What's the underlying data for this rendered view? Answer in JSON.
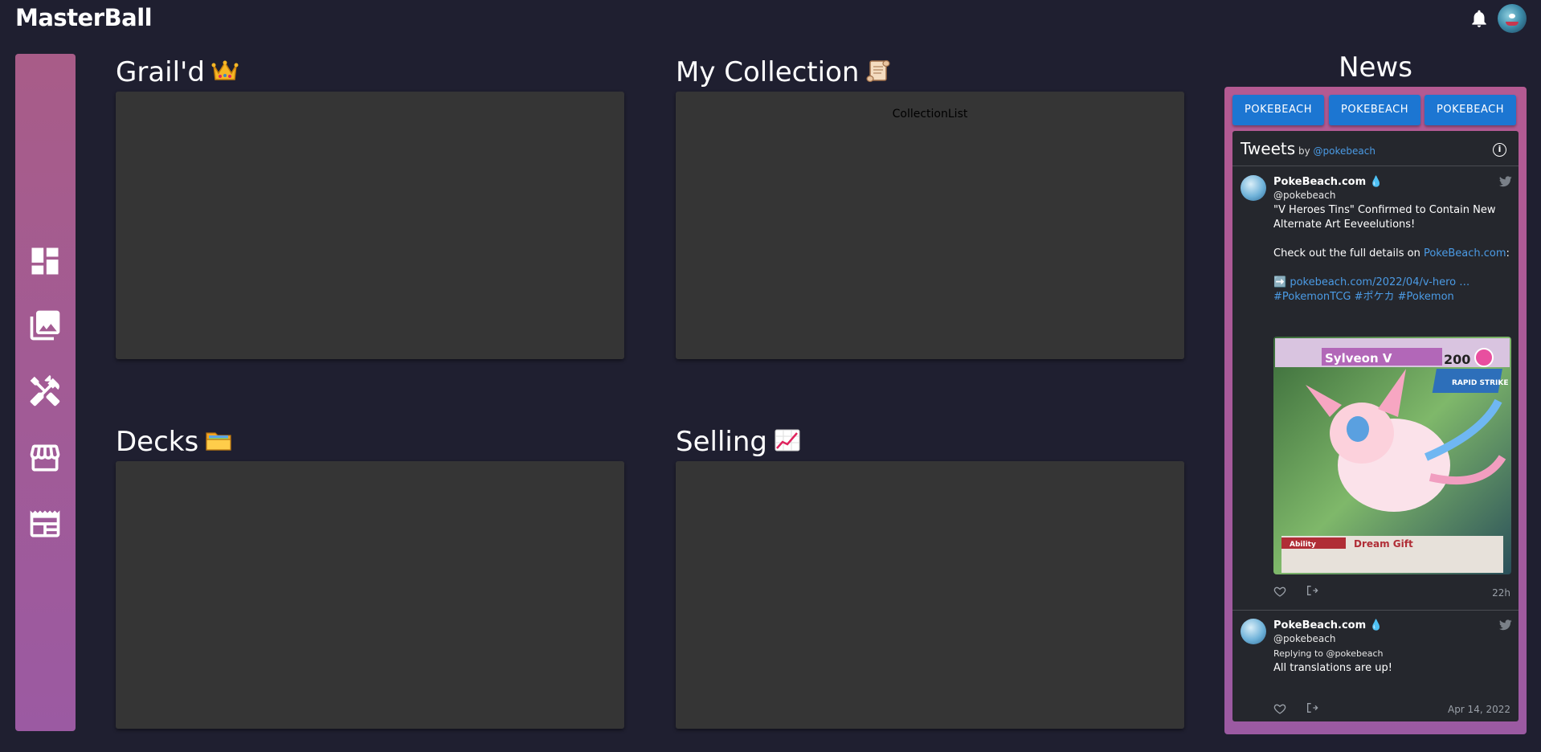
{
  "app": {
    "brand": "MasterBall",
    "notifications_icon": "bell-icon",
    "avatar_icon": "user-avatar"
  },
  "sidebar": {
    "items": [
      {
        "id": "dashboard",
        "icon": "dashboard-icon"
      },
      {
        "id": "collection",
        "icon": "photo-library-icon"
      },
      {
        "id": "tools",
        "icon": "tools-icon"
      },
      {
        "id": "store",
        "icon": "storefront-icon"
      },
      {
        "id": "news",
        "icon": "newspaper-icon"
      }
    ],
    "colors": {
      "top": "#a85c88",
      "bottom": "#9b5aa2"
    }
  },
  "sections": {
    "grailed": {
      "title": "Grail'd",
      "emoji": "crown-emoji"
    },
    "collection": {
      "title": "My Collection",
      "emoji": "scroll-emoji",
      "placeholder": "CollectionList"
    },
    "decks": {
      "title": "Decks",
      "emoji": "folder-emoji"
    },
    "selling": {
      "title": "Selling",
      "emoji": "chart-increasing-emoji"
    }
  },
  "news": {
    "title": "News",
    "sources": [
      "POKEBEACH",
      "POKEBEACH",
      "POKEBEACH"
    ],
    "button_color": "#1c76d2",
    "timeline": {
      "title": "Tweets",
      "by_prefix": "by",
      "by_handle": "@pokebeach",
      "info_label": "i"
    },
    "tweets": [
      {
        "name": "PokeBeach.com 💧",
        "handle": "@pokebeach",
        "line1": "\"V Heroes Tins\" Confirmed to Contain New Alternate Art Eeveelutions!",
        "line2_prefix": "Check out the full details on ",
        "line2_link": "PokeBeach.com",
        "line2_suffix": ":",
        "line3_link": "➡️ pokebeach.com/2022/04/v-hero …#PokemonTCG #ポケカ #Pokemon",
        "media": {
          "card_name": "Sylveon V",
          "hp": "200",
          "ability_label": "Ability",
          "ability_name": "Dream Gift",
          "style": "RAPID STRIKE"
        },
        "time": "22h"
      },
      {
        "name": "PokeBeach.com 💧",
        "handle": "@pokebeach",
        "reply_to": "Replying to @pokebeach",
        "text": "All translations are up!",
        "time": "Apr 14, 2022"
      }
    ]
  }
}
